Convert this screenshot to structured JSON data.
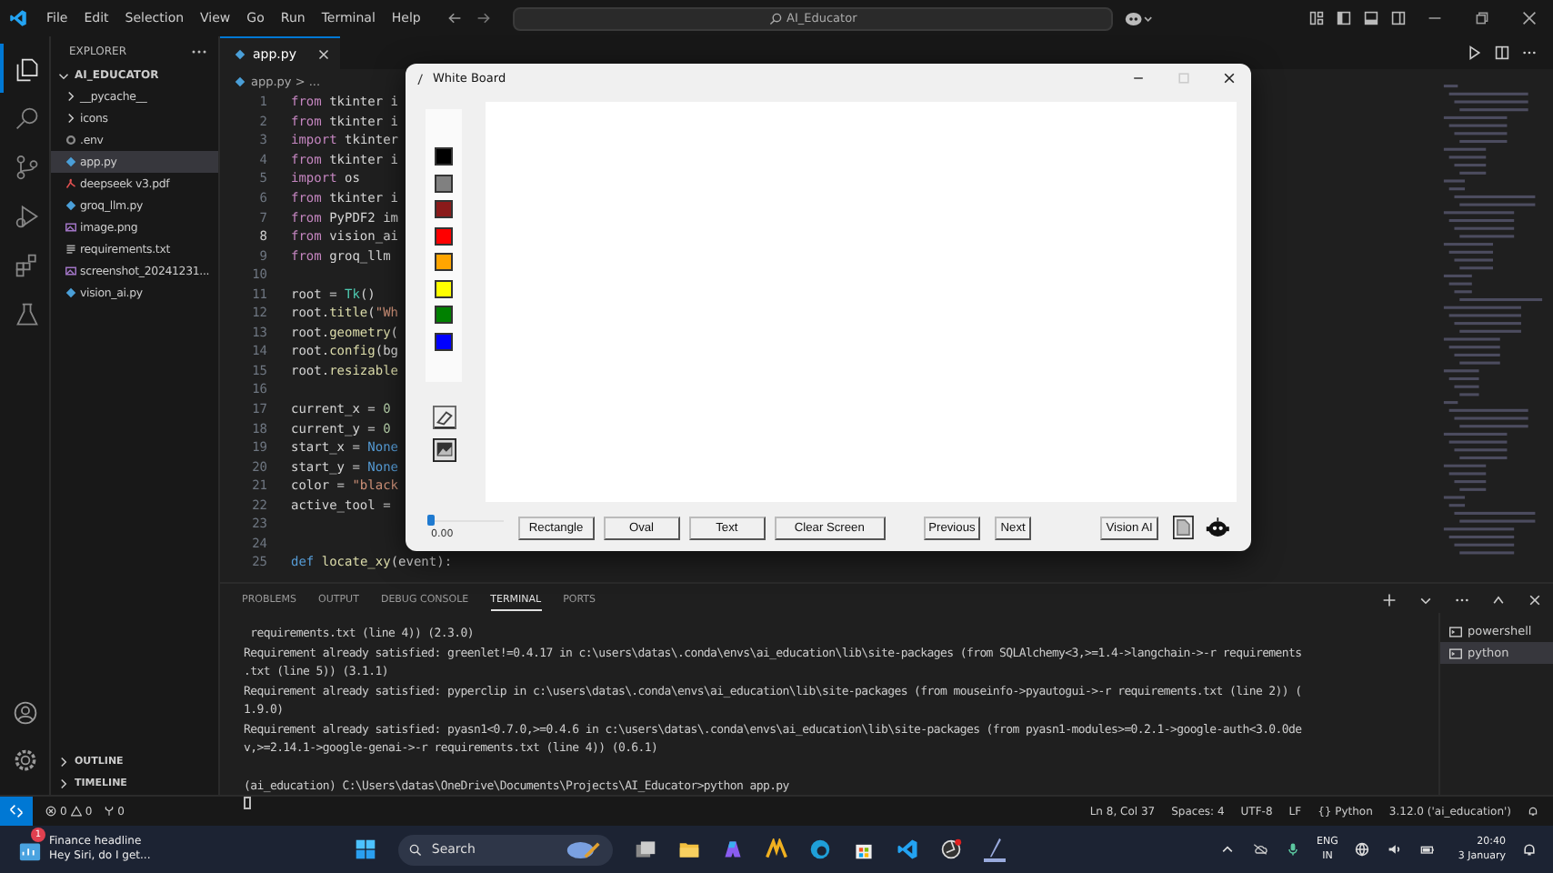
{
  "titlebar": {
    "menu": [
      "File",
      "Edit",
      "Selection",
      "View",
      "Go",
      "Run",
      "Terminal",
      "Help"
    ],
    "search": "AI_Educator"
  },
  "activity_bar": {
    "items": [
      {
        "kind": "explorer",
        "selected": true
      },
      {
        "kind": "search",
        "selected": false
      },
      {
        "kind": "source-control",
        "selected": false
      },
      {
        "kind": "run",
        "selected": false
      },
      {
        "kind": "extensions",
        "selected": false
      },
      {
        "kind": "testing",
        "selected": false
      }
    ]
  },
  "sidebar": {
    "title": "EXPLORER",
    "folder": "AI_EDUCATOR",
    "items": [
      {
        "name": "__pycache__",
        "kind": "folder",
        "selected": false
      },
      {
        "name": "icons",
        "kind": "folder",
        "selected": false
      },
      {
        "name": ".env",
        "kind": "env",
        "selected": false
      },
      {
        "name": "app.py",
        "kind": "python",
        "selected": true
      },
      {
        "name": "deepseek v3.pdf",
        "kind": "pdf",
        "selected": false
      },
      {
        "name": "groq_llm.py",
        "kind": "python",
        "selected": false
      },
      {
        "name": "image.png",
        "kind": "image",
        "selected": false
      },
      {
        "name": "requirements.txt",
        "kind": "text",
        "selected": false
      },
      {
        "name": "screenshot_20241231...",
        "kind": "image",
        "selected": false
      },
      {
        "name": "vision_ai.py",
        "kind": "python",
        "selected": false
      }
    ],
    "sections": [
      "OUTLINE",
      "TIMELINE"
    ]
  },
  "editor": {
    "tab": "app.py",
    "breadcrumb": "app.py > ...",
    "lines": [
      {
        "number": "1",
        "current": false,
        "tokens": [
          {
            "kind": "keyword",
            "text": "from"
          },
          {
            "kind": "plain",
            "text": " tkinter i"
          }
        ]
      },
      {
        "number": "2",
        "current": false,
        "tokens": [
          {
            "kind": "keyword",
            "text": "from"
          },
          {
            "kind": "plain",
            "text": " tkinter i"
          }
        ]
      },
      {
        "number": "3",
        "current": false,
        "tokens": [
          {
            "kind": "keyword",
            "text": "import"
          },
          {
            "kind": "plain",
            "text": " tkinter"
          }
        ]
      },
      {
        "number": "4",
        "current": false,
        "tokens": [
          {
            "kind": "keyword",
            "text": "from"
          },
          {
            "kind": "plain",
            "text": " tkinter i"
          }
        ]
      },
      {
        "number": "5",
        "current": false,
        "tokens": [
          {
            "kind": "keyword",
            "text": "import"
          },
          {
            "kind": "plain",
            "text": " os"
          }
        ]
      },
      {
        "number": "6",
        "current": false,
        "tokens": [
          {
            "kind": "keyword",
            "text": "from"
          },
          {
            "kind": "plain",
            "text": " tkinter i"
          }
        ]
      },
      {
        "number": "7",
        "current": false,
        "tokens": [
          {
            "kind": "keyword",
            "text": "from"
          },
          {
            "kind": "plain",
            "text": " PyPDF2 im"
          }
        ]
      },
      {
        "number": "8",
        "current": true,
        "tokens": [
          {
            "kind": "keyword",
            "text": "from"
          },
          {
            "kind": "plain",
            "text": " vision_ai"
          }
        ]
      },
      {
        "number": "9",
        "current": false,
        "tokens": [
          {
            "kind": "keyword",
            "text": "from"
          },
          {
            "kind": "plain",
            "text": " groq_llm"
          }
        ]
      },
      {
        "number": "10",
        "current": false
      },
      {
        "number": "11",
        "current": false,
        "tokens": [
          {
            "kind": "plain",
            "text": "root = "
          },
          {
            "kind": "class",
            "text": "Tk"
          },
          {
            "kind": "plain",
            "text": "()"
          }
        ]
      },
      {
        "number": "12",
        "current": false,
        "tokens": [
          {
            "kind": "plain",
            "text": "root."
          },
          {
            "kind": "func",
            "text": "title"
          },
          {
            "kind": "plain",
            "text": "("
          },
          {
            "kind": "string",
            "text": "\"Wh"
          }
        ]
      },
      {
        "number": "13",
        "current": false,
        "tokens": [
          {
            "kind": "plain",
            "text": "root."
          },
          {
            "kind": "func",
            "text": "geometry"
          },
          {
            "kind": "plain",
            "text": "("
          }
        ]
      },
      {
        "number": "14",
        "current": false,
        "tokens": [
          {
            "kind": "plain",
            "text": "root."
          },
          {
            "kind": "func",
            "text": "config"
          },
          {
            "kind": "plain",
            "text": "(bg"
          }
        ]
      },
      {
        "number": "15",
        "current": false,
        "tokens": [
          {
            "kind": "plain",
            "text": "root."
          },
          {
            "kind": "func",
            "text": "resizable"
          }
        ]
      },
      {
        "number": "16",
        "current": false
      },
      {
        "number": "17",
        "current": false,
        "tokens": [
          {
            "kind": "plain",
            "text": "current_x = "
          },
          {
            "kind": "number",
            "text": "0"
          }
        ]
      },
      {
        "number": "18",
        "current": false,
        "tokens": [
          {
            "kind": "plain",
            "text": "current_y = "
          },
          {
            "kind": "number",
            "text": "0"
          }
        ]
      },
      {
        "number": "19",
        "current": false,
        "tokens": [
          {
            "kind": "plain",
            "text": "start_x = "
          },
          {
            "kind": "const",
            "text": "None"
          }
        ]
      },
      {
        "number": "20",
        "current": false,
        "tokens": [
          {
            "kind": "plain",
            "text": "start_y = "
          },
          {
            "kind": "const",
            "text": "None"
          }
        ]
      },
      {
        "number": "21",
        "current": false,
        "tokens": [
          {
            "kind": "plain",
            "text": "color = "
          },
          {
            "kind": "string",
            "text": "\"black"
          }
        ]
      },
      {
        "number": "22",
        "current": false,
        "tokens": [
          {
            "kind": "plain",
            "text": "active_tool = "
          }
        ]
      },
      {
        "number": "23",
        "current": false
      },
      {
        "number": "24",
        "current": false
      },
      {
        "number": "25",
        "current": false,
        "tokens": [
          {
            "kind": "const",
            "text": "def"
          },
          {
            "kind": "func",
            "text": " locate_xy"
          },
          {
            "kind": "plain",
            "text": "(event):"
          }
        ]
      }
    ]
  },
  "whiteboard": {
    "title": "White Board",
    "palette": [
      {
        "color": "#000000"
      },
      {
        "color": "#808080"
      },
      {
        "color": "#8b1a1a"
      },
      {
        "color": "#ff0000"
      },
      {
        "color": "#ffa500"
      },
      {
        "color": "#ffff00"
      },
      {
        "color": "#008000"
      },
      {
        "color": "#0000ff"
      }
    ],
    "slider": {
      "level": 0.0,
      "reading": "0.00"
    },
    "buttons": [
      {
        "label": "Rectangle",
        "kind": "shape"
      },
      {
        "label": "Oval",
        "kind": "shape"
      },
      {
        "label": "Text",
        "kind": "shape"
      },
      {
        "label": "Clear Screen",
        "kind": "shape"
      },
      {
        "label": "Previous",
        "kind": "nav"
      },
      {
        "label": "Next",
        "kind": "nav"
      },
      {
        "label": "Vision AI",
        "kind": "ai"
      }
    ]
  },
  "panel": {
    "tabs": [
      {
        "label": "PROBLEMS",
        "selected": false
      },
      {
        "label": "OUTPUT",
        "selected": false
      },
      {
        "label": "DEBUG CONSOLE",
        "selected": false
      },
      {
        "label": "TERMINAL",
        "selected": true
      },
      {
        "label": "PORTS",
        "selected": false
      }
    ],
    "terminal_lines": [
      {
        "kind": "output",
        "text": " requirements.txt (line 4)) (2.3.0)"
      },
      {
        "kind": "output",
        "text": "Requirement already satisfied: greenlet!=0.4.17 in c:\\users\\datas\\.conda\\envs\\ai_education\\lib\\site-packages (from SQLAlchemy<3,>=1.4->langchain->-r requirements"
      },
      {
        "kind": "output",
        "text": ".txt (line 5)) (3.1.1)"
      },
      {
        "kind": "output",
        "text": "Requirement already satisfied: pyperclip in c:\\users\\datas\\.conda\\envs\\ai_education\\lib\\site-packages (from mouseinfo->pyautogui->-r requirements.txt (line 2)) ("
      },
      {
        "kind": "output",
        "text": "1.9.0)"
      },
      {
        "kind": "output",
        "text": "Requirement already satisfied: pyasn1<0.7.0,>=0.4.6 in c:\\users\\datas\\.conda\\envs\\ai_education\\lib\\site-packages (from pyasn1-modules>=0.2.1->google-auth<3.0.0de"
      },
      {
        "kind": "output",
        "text": "v,>=2.14.1->google-genai->-r requirements.txt (line 4)) (0.6.1)"
      },
      {
        "kind": "prompt",
        "text": "(ai_education) C:\\Users\\datas\\OneDrive\\Documents\\Projects\\AI_Educator>python app.py"
      }
    ],
    "terminals": [
      {
        "name": "powershell",
        "selected": false
      },
      {
        "name": "python",
        "selected": true
      }
    ]
  },
  "status_bar": {
    "errors": "0",
    "warnings": "0",
    "ports": "0",
    "right": [
      "Ln 8, Col 37",
      "Spaces: 4",
      "UTF-8",
      "LF",
      "{} Python",
      "3.12.0 ('ai_education')"
    ]
  },
  "taskbar": {
    "widget": {
      "badge": "1",
      "title": "Finance headline",
      "subtitle": "Hey Siri, do I get..."
    },
    "search": "Search",
    "language": "ENG",
    "region": "IN",
    "time": "20:40",
    "date": "3 January"
  }
}
